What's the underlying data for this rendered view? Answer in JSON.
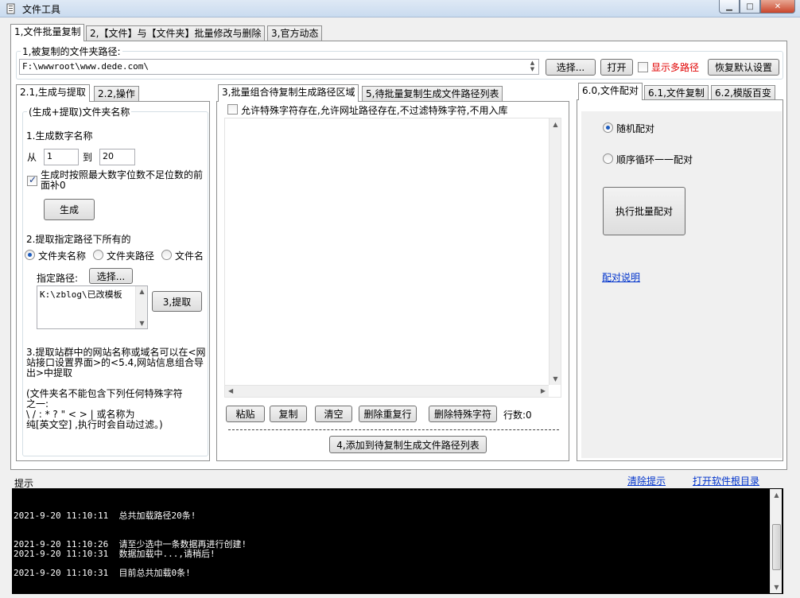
{
  "window": {
    "title": "文件工具"
  },
  "main_tabs": [
    "1,文件批量复制",
    "2,【文件】与【文件夹】批量修改与删除",
    "3,官方动态"
  ],
  "source": {
    "label": "1,被复制的文件夹路径:",
    "path": "F:\\wwwroot\\www.dede.com\\",
    "select_btn": "选择...",
    "open_btn": "打开",
    "show_multi": "显示多路径",
    "restore_btn": "恢复默认设置"
  },
  "left": {
    "tabs": [
      "2.1,生成与提取",
      "2.2,操作"
    ],
    "group_title": "(生成+提取)文件夹名称",
    "gen_title": "1.生成数字名称",
    "from_label": "从",
    "from_value": "1",
    "to_label": "到",
    "to_value": "20",
    "pad_zero_line1": "生成时按照最大数字位数不足位数的前",
    "pad_zero_line2": "面补0",
    "gen_btn": "生成",
    "extract_title": "2.提取指定路径下所有的",
    "radio_folder": "文件夹名称",
    "radio_path": "文件夹路径",
    "radio_file": "文件名",
    "path_label": "指定路径:",
    "path_select_btn": "选择...",
    "path_value": "K:\\zblog\\已改模板",
    "extract_btn": "3,提取",
    "note3_line1": "3.提取站群中的网站名称或域名可以在<网",
    "note3_line2": "站接口设置界面>的<5.4,网站信息组合导",
    "note3_line3": "出>中提取",
    "note_chars_line1": "(文件夹名不能包含下列任何特殊字符",
    "note_chars_line2": "之一:",
    "note_chars_line3": "  \\ / : * ? \" < > | 或名称为",
    "note_chars_line4": "纯[英文空] ,执行时会自动过滤。)"
  },
  "middle": {
    "tabs": [
      "3,批量组合待复制生成路径区域",
      "5,待批量复制生成文件路径列表"
    ],
    "allow_special": "允许特殊字符存在,允许网址路径存在,不过滤特殊字符,不用入库",
    "paste_btn": "粘贴",
    "copy_btn": "复制",
    "clear_btn": "清空",
    "dedupe_btn": "删除重复行",
    "del_special_btn": "删除特殊字符",
    "row_count": "行数:0",
    "add_btn": "4,添加到待复制生成文件路径列表"
  },
  "right": {
    "tabs": [
      "6.0,文件配对",
      "6.1,文件复制",
      "6.2,模版百变"
    ],
    "radio_random": "随机配对",
    "radio_sequential": "顺序循环一一配对",
    "exec_btn": "执行批量配对",
    "help_link": "配对说明"
  },
  "log": {
    "label": "提示",
    "clear_link": "清除提示",
    "open_root_link": "打开软件根目录",
    "lines": [
      "2021-9-20 11:10:11  总共加载路径20条!",
      "2021-9-20 11:10:26  请至少选中一条数据再进行创建!",
      "2021-9-20 11:10:31  数据加载中...,请稍后!",
      "2021-9-20 11:10:31  目前总共加载0条!"
    ]
  }
}
